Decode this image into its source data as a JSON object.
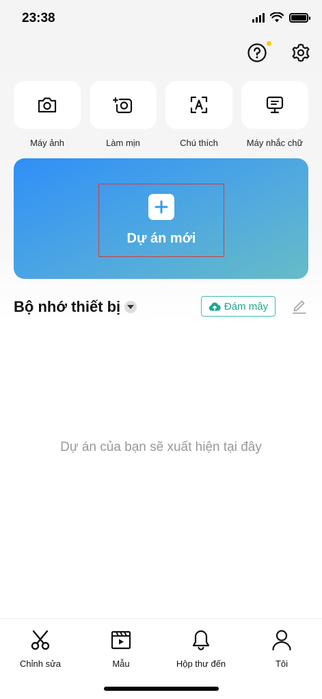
{
  "status_bar": {
    "time": "23:38"
  },
  "top_actions": {
    "help_icon": "question-circle-icon",
    "settings_icon": "gear-icon"
  },
  "tools": [
    {
      "label": "Máy ảnh",
      "icon": "camera-icon"
    },
    {
      "label": "Làm mịn",
      "icon": "retouch-icon"
    },
    {
      "label": "Chú thích",
      "icon": "auto-caption-icon"
    },
    {
      "label": "Máy nhắc chữ",
      "icon": "teleprompter-icon"
    }
  ],
  "new_project": {
    "label": "Dự án mới",
    "plus": "+"
  },
  "storage": {
    "title": "Bộ nhớ thiết bị",
    "cloud_label": "Đám mây",
    "empty_text": "Dự án của bạn sẽ xuất hiện tại đây"
  },
  "bottom_nav": [
    {
      "label": "Chỉnh sửa",
      "icon": "scissors-icon"
    },
    {
      "label": "Mẫu",
      "icon": "template-icon"
    },
    {
      "label": "Hộp thư đến",
      "icon": "bell-icon"
    },
    {
      "label": "Tôi",
      "icon": "person-icon"
    }
  ],
  "colors": {
    "accent_gradient_start": "#2f8ff7",
    "accent_gradient_end": "#66bcc6",
    "cloud_green": "#21a88e",
    "notif_dot": "#f5d000"
  }
}
